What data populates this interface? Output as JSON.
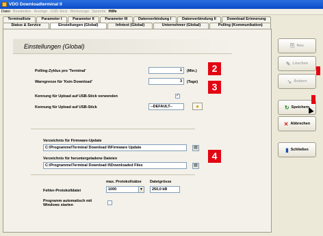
{
  "window": {
    "title": "VDO Downloadterminal II"
  },
  "menu": {
    "items": [
      {
        "label": "Datei",
        "enabled": true,
        "bold": false
      },
      {
        "label": "Bearbeiten",
        "enabled": false,
        "bold": false
      },
      {
        "label": "Anzeige",
        "enabled": false,
        "bold": false
      },
      {
        "label": "USB-Stick",
        "enabled": false,
        "bold": false
      },
      {
        "label": "Werkzeuge",
        "enabled": false,
        "bold": false
      },
      {
        "label": "Sprache",
        "enabled": false,
        "bold": false
      },
      {
        "label": "Hilfe",
        "enabled": true,
        "bold": true
      }
    ]
  },
  "tabs": {
    "row1": [
      "Terminalliste",
      "Parameter I",
      "Parameter II",
      "Parameter III",
      "Datenverbindung I",
      "Datenverbindung II",
      "Download Erinnerung"
    ],
    "row2": [
      "Status & Service",
      "Einstellungen (Global)",
      "Infotext (Global)",
      "Unternehmer (Global)",
      "Polling (Kommunikation)"
    ],
    "active": "Einstellungen (Global)"
  },
  "panel": {
    "title": "Einstellungen (Global)",
    "polling_label": "Polling-Zyklus pro 'Terminal'",
    "polling_value": "1",
    "polling_unit": "(Min.)",
    "warn_label": "Warngrenze für 'Kein Download'",
    "warn_value": "3",
    "warn_unit": "(Tage)",
    "usb_check_label": "Kennung für Upload auf USB-Stick verwenden",
    "usb_check_checked": true,
    "usb_id_label": "Kennung für Upload auf USB-Stick",
    "usb_id_value": "--DEFAULT--",
    "firmware_label": "Verzeichnis für Firmware-Update",
    "firmware_path": "C:\\Programme\\Terminal Download II\\Firmware Update",
    "download_label": "Verzeichnis für heruntergeladene Dateien",
    "download_path": "C:\\Programme\\Terminal Download II\\Downloaded Files",
    "log_label": "Fehler-Protokolldatei",
    "max_logs_header": "max. Protokollsätze",
    "max_logs_value": "1000",
    "filesize_header": "Dateigrösse",
    "filesize_value": "250,0 kB",
    "autostart_label": "Programm automatisch mit Windows starten",
    "autostart_checked": false
  },
  "badges": [
    "2",
    "3",
    "4"
  ],
  "sidebar": {
    "buttons": [
      {
        "label": "Neu",
        "enabled": false,
        "icon": "new-icon"
      },
      {
        "label": "Löschen",
        "enabled": false,
        "icon": "delete-icon"
      },
      {
        "label": "Ändern",
        "enabled": false,
        "icon": "edit-icon"
      },
      {
        "label": "Speichern",
        "enabled": true,
        "icon": "save-icon"
      },
      {
        "label": "Abbrechen",
        "enabled": true,
        "icon": "cancel-icon"
      },
      {
        "label": "Schließen",
        "enabled": true,
        "icon": "close-door-icon"
      }
    ]
  },
  "colors": {
    "accent_red": "#e30613",
    "title_blue": "#0a4bc8"
  }
}
